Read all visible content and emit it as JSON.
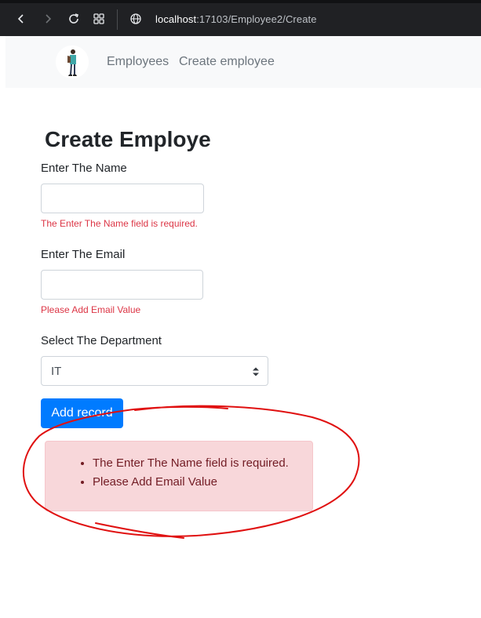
{
  "browser": {
    "url_host": "localhost",
    "url_path": ":17103/Employee2/Create"
  },
  "navbar": {
    "links": [
      "Employees",
      "Create employee"
    ]
  },
  "page": {
    "title": "Create Employe"
  },
  "form": {
    "name_label": "Enter The Name",
    "name_value": "",
    "name_error": "The Enter The Name field is required.",
    "email_label": "Enter The Email",
    "email_value": "",
    "email_error": "Please Add Email Value",
    "department_label": "Select The Department",
    "department_selected": "IT",
    "submit_label": "Add record"
  },
  "validation_summary": {
    "errors": [
      "The Enter The Name field is required.",
      "Please Add Email Value"
    ]
  },
  "colors": {
    "primary": "#007bff",
    "danger": "#dc3545",
    "alert_bg": "#f8d7da",
    "annotation": "#e01010"
  }
}
